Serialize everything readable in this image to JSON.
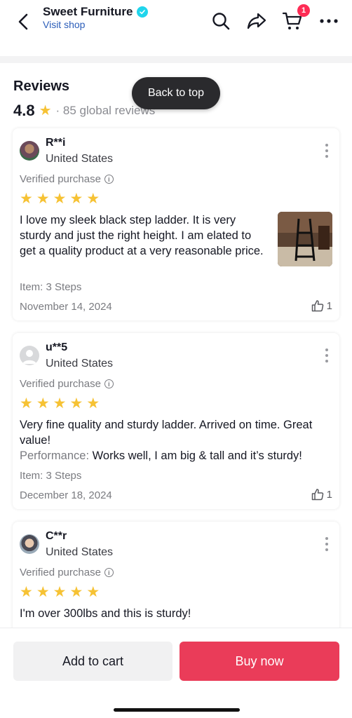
{
  "header": {
    "shop_name": "Sweet Furniture",
    "visit_shop": "Visit shop",
    "cart_count": "1",
    "icons": [
      "back-arrow-icon",
      "search-icon",
      "share-icon",
      "cart-icon",
      "more-icon"
    ]
  },
  "reviews": {
    "title": "Reviews",
    "rating": "4.8",
    "count_text": "· 85 global reviews",
    "back_to_top": "Back to top",
    "items": [
      {
        "reviewer": "R**i",
        "country": "United States",
        "verified": "Verified purchase",
        "stars": 5,
        "text": "I love my sleek black step ladder. It is very sturdy and just the right height. I am elated to get a quality product at a very reasonable price.",
        "item": "Item: 3 Steps",
        "date": "November 14, 2024",
        "likes": "1"
      },
      {
        "reviewer": "u**5",
        "country": "United States",
        "verified": "Verified purchase",
        "stars": 5,
        "text": "Very fine quality and sturdy ladder. Arrived on time. Great value!",
        "perf_label": "Performance:",
        "perf_text": "Works well, I am big & tall and it’s sturdy!",
        "item": "Item: 3 Steps",
        "date": "December 18, 2024",
        "likes": "1"
      },
      {
        "reviewer": "C**r",
        "country": "United States",
        "verified": "Verified purchase",
        "stars": 5,
        "text": "I'm over 300lbs and this is sturdy!"
      }
    ]
  },
  "actions": {
    "add_to_cart": "Add to cart",
    "buy_now": "Buy now"
  },
  "colors": {
    "star": "#f6c234",
    "buy_now": "#ea3c59",
    "link": "#2b5db9",
    "badge": "#fe2c55"
  }
}
